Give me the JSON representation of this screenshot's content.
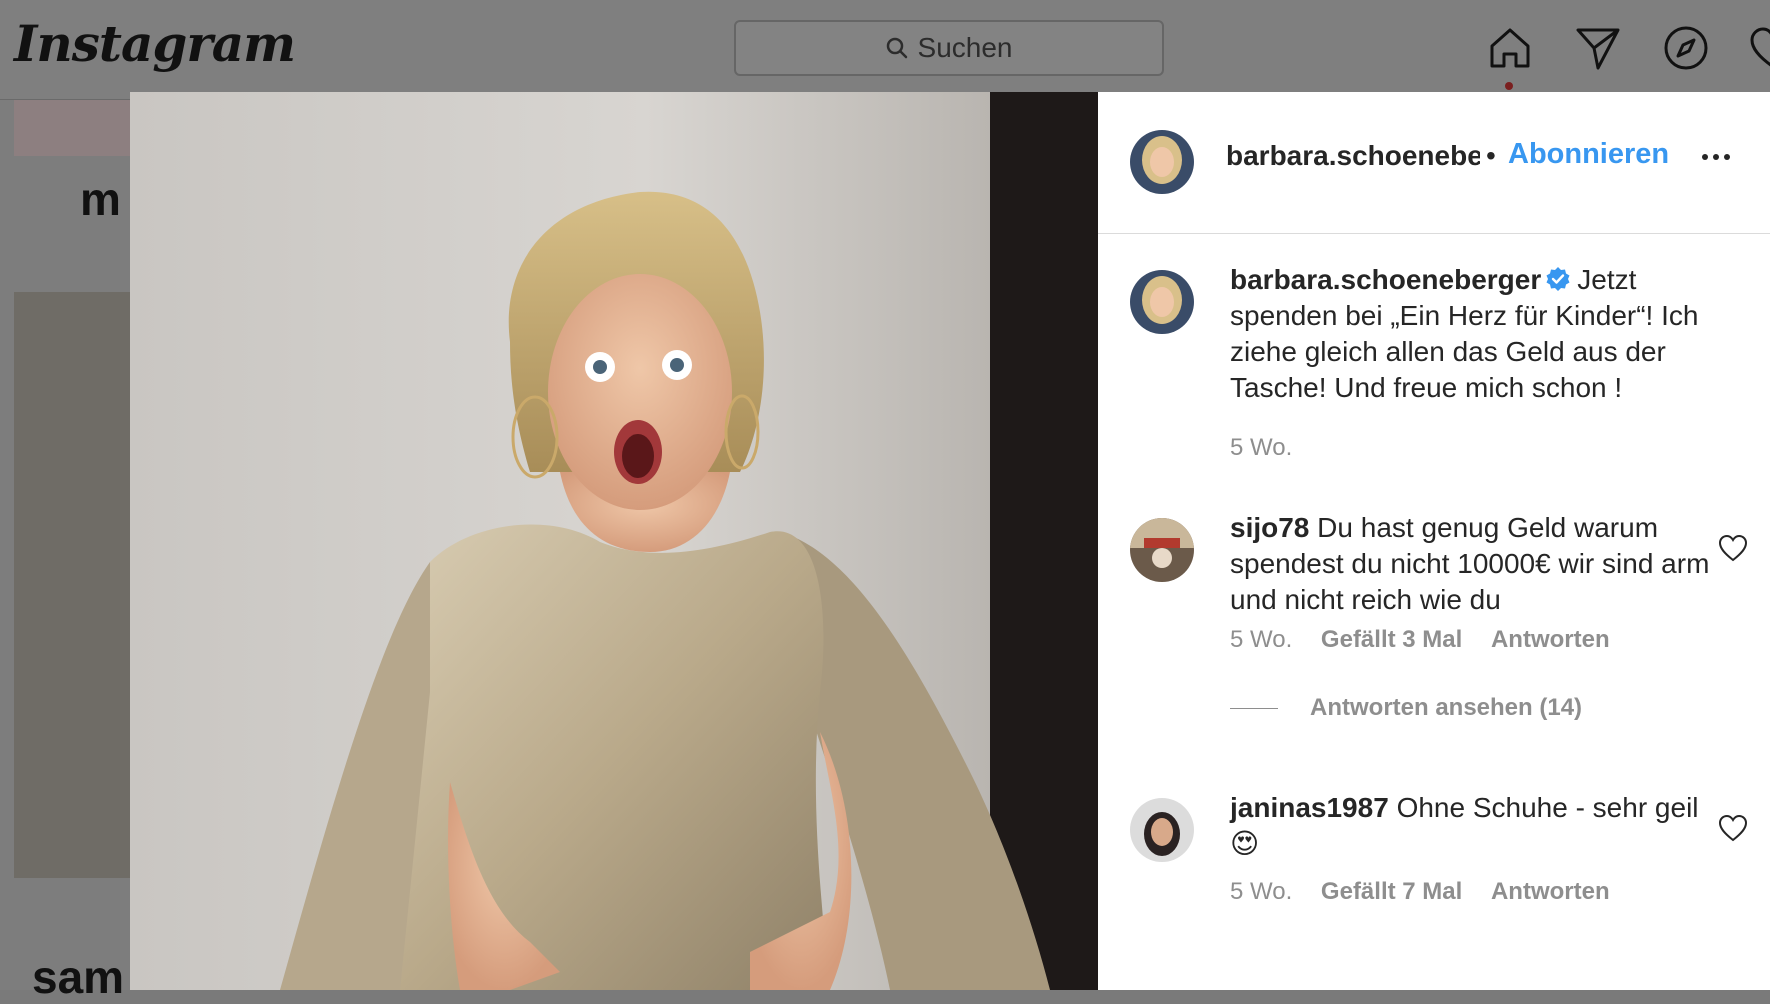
{
  "app": {
    "logo_text": "Instagram"
  },
  "search": {
    "placeholder": "Suchen",
    "icon": "search-icon"
  },
  "nav": {
    "icons": [
      "home-icon",
      "direct-message-icon",
      "explore-compass-icon",
      "activity-heart-icon"
    ]
  },
  "background": {
    "text_top": "m",
    "text_bottom": "sam"
  },
  "post": {
    "author": "barbara.schoeneberger",
    "author_truncated": "barbara.schoenebe",
    "separator": "•",
    "follow_label": "Abonnieren",
    "caption": {
      "username": "barbara.schoeneberger",
      "verified": true,
      "text": "Jetzt spenden bei „Ein Herz für Kinder“! Ich ziehe gleich allen das Geld aus der Tasche! Und freue mich schon !",
      "age": "5 Wo."
    },
    "comments": [
      {
        "username": "sijo78",
        "text": "Du hast genug Geld warum spendest du nicht 10000€ wir sind arm und nicht reich wie du",
        "age": "5 Wo.",
        "likes": "Gefällt 3 Mal",
        "reply": "Antworten",
        "view_replies": "Antworten ansehen (14)"
      },
      {
        "username": "janinas1987",
        "text": "Ohne Schuhe - sehr geil",
        "emoji": "😍",
        "age": "5 Wo.",
        "likes": "Gefällt 7 Mal",
        "reply": "Antworten"
      }
    ]
  },
  "colors": {
    "link_blue": "#3897f0",
    "text": "#262626",
    "muted": "#8e8e8e",
    "verified_blue": "#3897f0"
  }
}
